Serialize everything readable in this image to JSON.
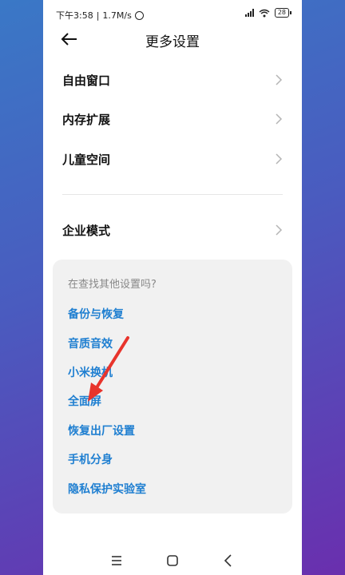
{
  "status": {
    "time": "下午3:58",
    "network_speed": "1.7M/s",
    "battery": "28",
    "icons": [
      "alarm-icon",
      "signal-icon",
      "wifi-icon",
      "battery-icon"
    ]
  },
  "header": {
    "title": "更多设置"
  },
  "settings": {
    "items": [
      {
        "label": "自由窗口"
      },
      {
        "label": "内存扩展"
      },
      {
        "label": "儿童空间"
      },
      {
        "label": "企业模式"
      }
    ]
  },
  "suggestions": {
    "hint": "在查找其他设置吗?",
    "links": [
      {
        "label": "备份与恢复"
      },
      {
        "label": "音质音效"
      },
      {
        "label": "小米换机"
      },
      {
        "label": "全面屏"
      },
      {
        "label": "恢复出厂设置"
      },
      {
        "label": "手机分身"
      },
      {
        "label": "隐私保护实验室"
      }
    ]
  },
  "colors": {
    "accent_link": "#1f7fd1",
    "annotation_arrow": "#e8342c"
  },
  "navbar": {
    "icons": [
      "menu-icon",
      "home-icon",
      "back-triangle-icon"
    ]
  }
}
